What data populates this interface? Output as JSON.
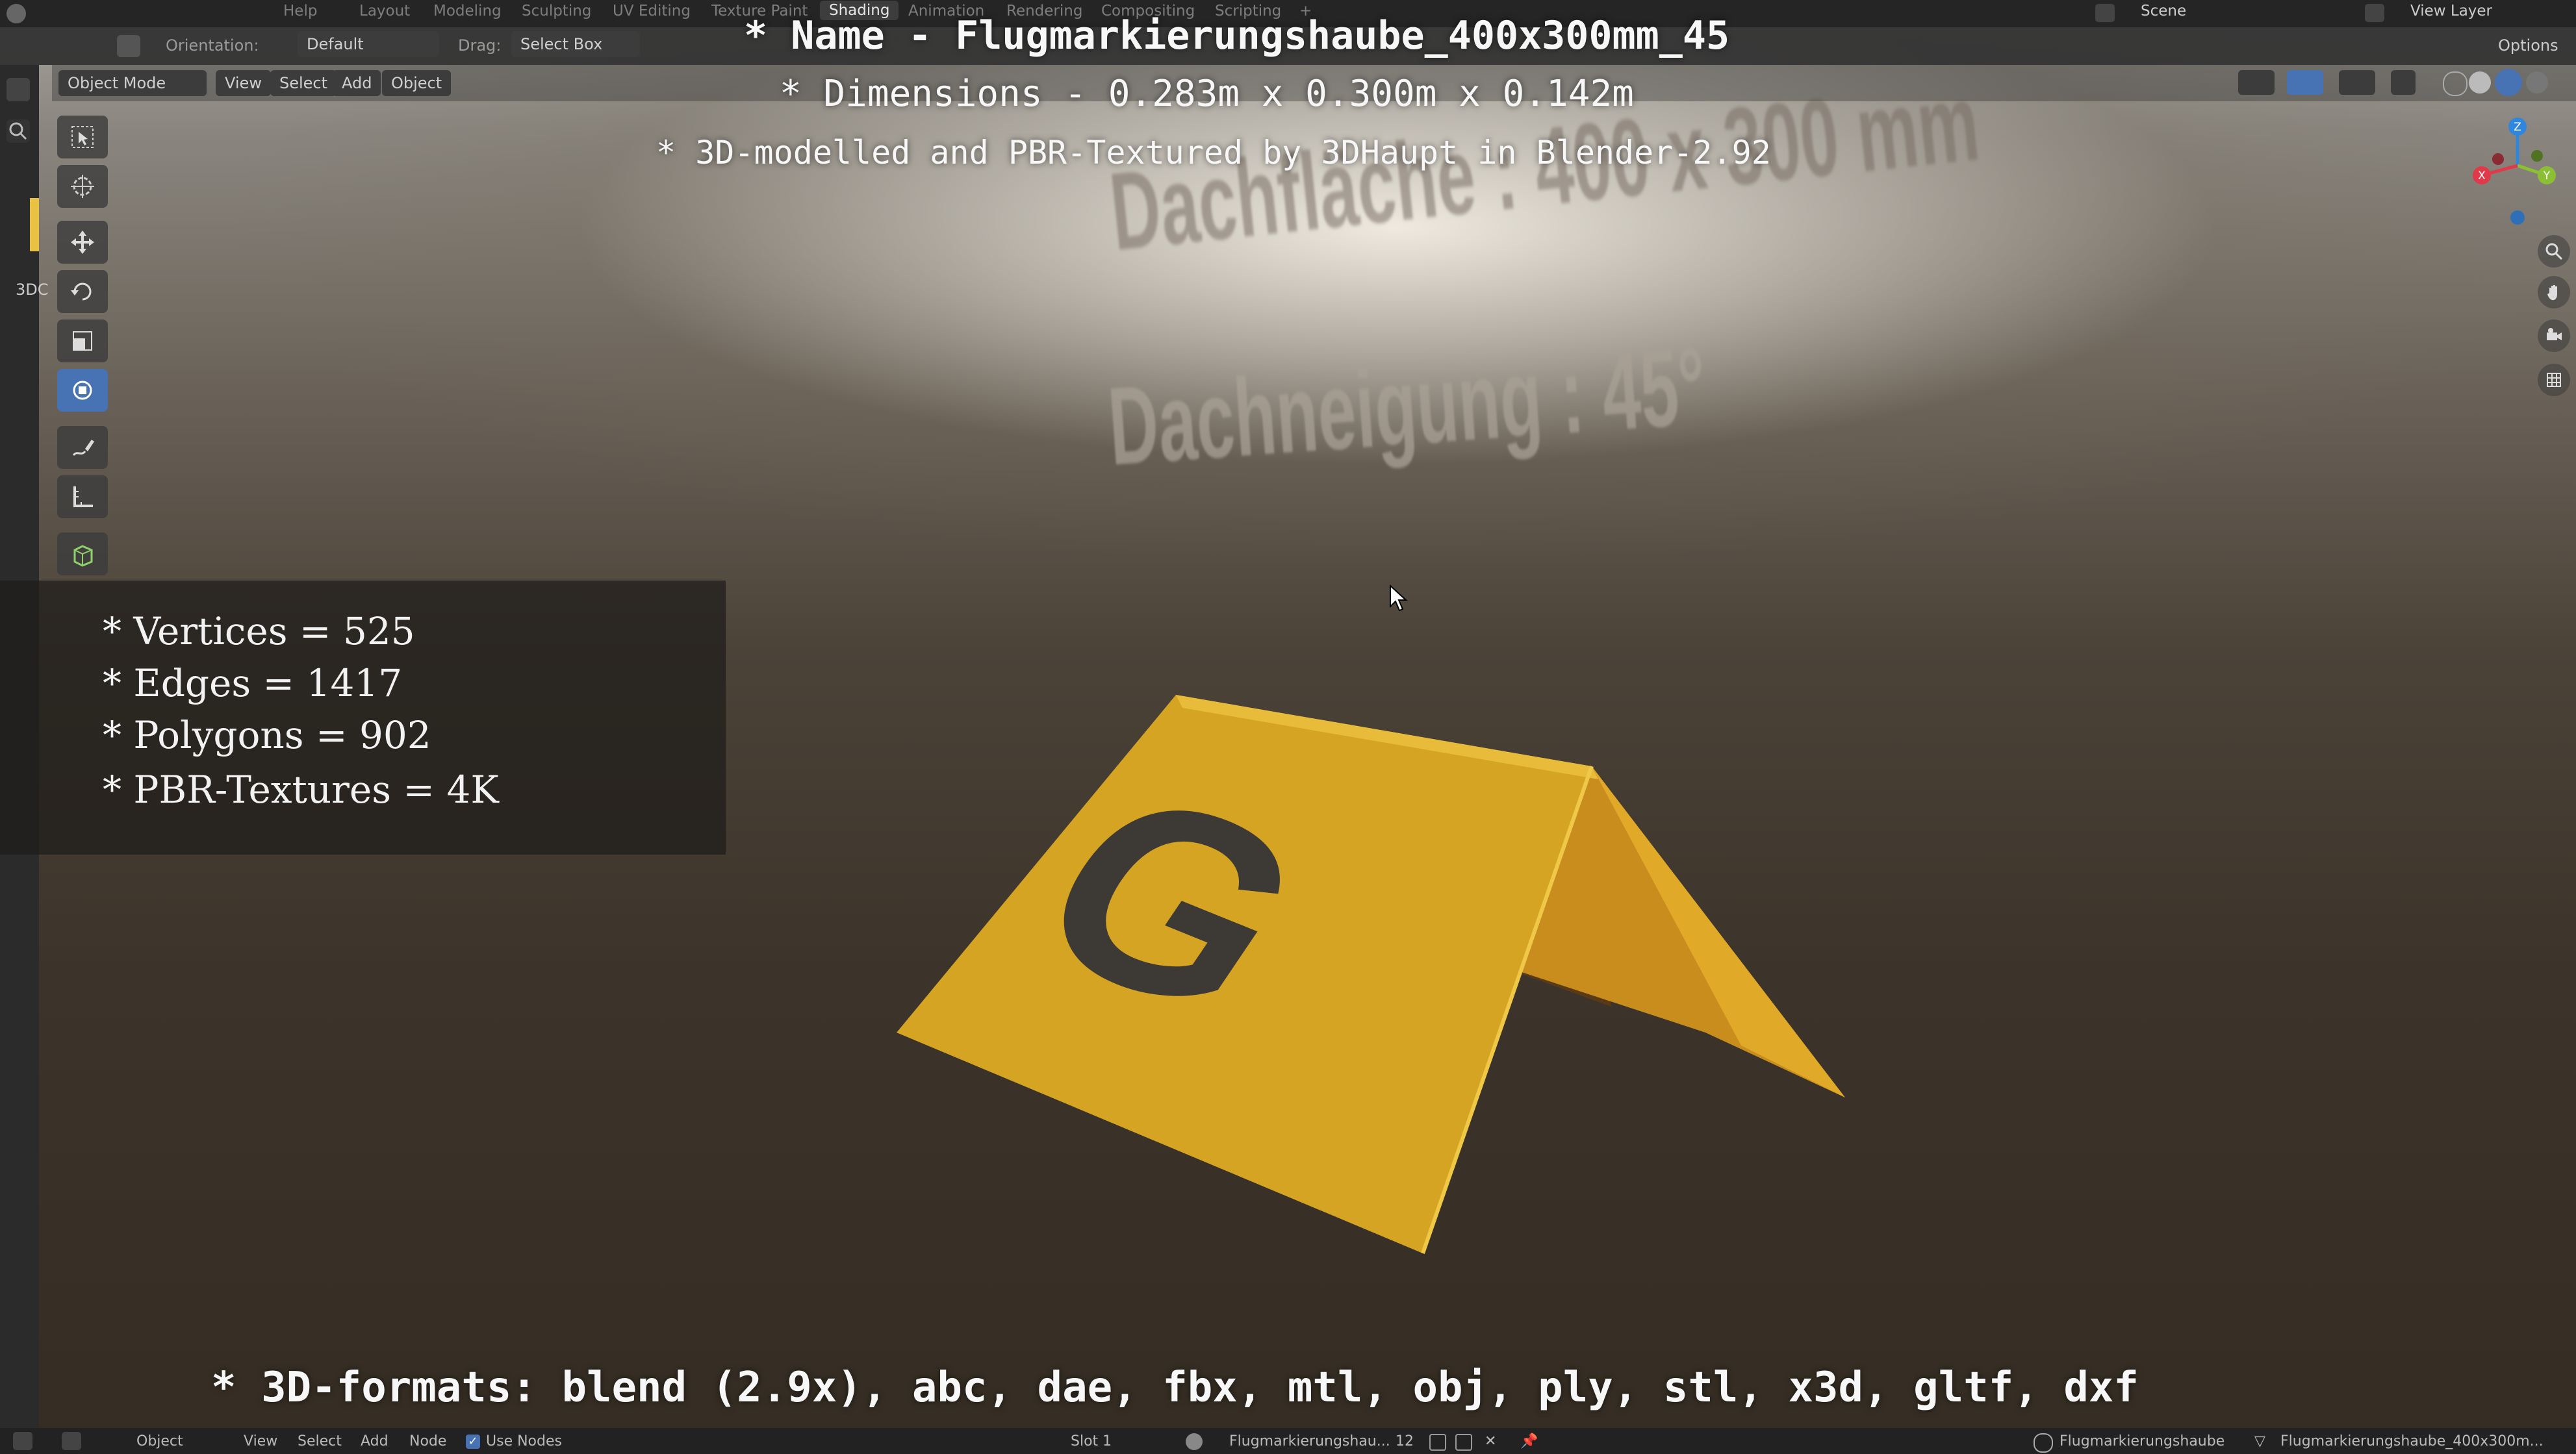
{
  "topbar": {
    "menu_help": "Help",
    "tabs": [
      "Layout",
      "Modeling",
      "Sculpting",
      "UV Editing",
      "Texture Paint",
      "Shading",
      "Animation",
      "Rendering",
      "Compositing",
      "Scripting"
    ],
    "active_tab": "Shading",
    "scene_label": "Scene",
    "view_layer_label": "View Layer"
  },
  "toolheader": {
    "orientation_label": "Orientation:",
    "orientation_value": "Default",
    "drag_label": "Drag:",
    "drag_value": "Select Box",
    "options_label": "Options"
  },
  "modeheader": {
    "mode": "Object Mode",
    "menu": [
      "View",
      "Select",
      "Add",
      "Object"
    ]
  },
  "captions": {
    "name": "* Name - Flugmarkierungshaube_400x300mm_45",
    "dimensions": "* Dimensions -  0.283m x 0.300m x 0.142m",
    "credit": "* 3D-modelled and PBR-Textured by 3DHaupt in Blender-2.92",
    "formats": "* 3D-formats: blend (2.9x), abc, dae, fbx, mtl, obj, ply, stl, x3d, gltf, dxf"
  },
  "stats": {
    "vertices": "* Vertices = 525",
    "edges": "* Edges = 1417",
    "polygons": "* Polygons = 902",
    "textures": "* PBR-Textures = 4K"
  },
  "scene_text": {
    "line1": "Dachfläche :  400 x 300 mm",
    "line2": "Dachneigung :  45°",
    "marker_letter": "G"
  },
  "left_label": "3DC",
  "bottombar": {
    "object_label": "Object",
    "menu": [
      "View",
      "Select",
      "Add",
      "Node"
    ],
    "use_nodes": "Use Nodes",
    "slot": "Slot 1",
    "material": "Flugmarkierungshau...",
    "users": "12",
    "object_name": "Flugmarkierungshaube",
    "mesh_name": "Flugmarkierungshaube_400x300m..."
  },
  "colors": {
    "accent": "#4772b3",
    "marker_yellow": "#d7a722",
    "axis_x": "#e0394a",
    "axis_y": "#8bc034",
    "axis_z": "#2e86de"
  }
}
